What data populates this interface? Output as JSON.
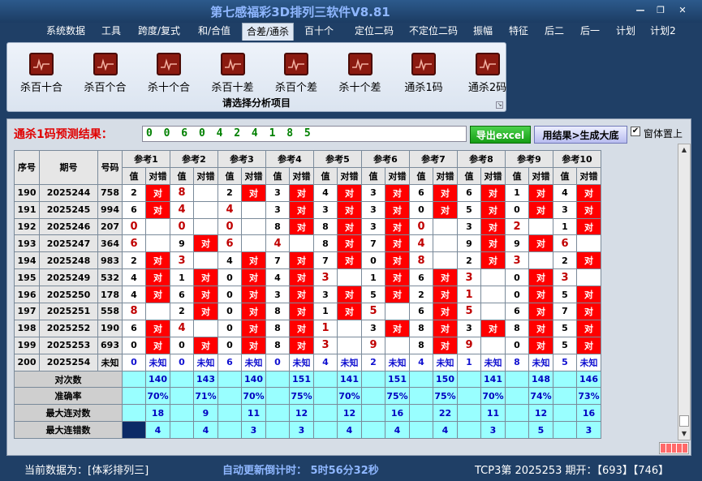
{
  "window": {
    "title": "第七感福彩3D排列三软件V8.81",
    "buttons": [
      "—",
      "❐",
      "✕"
    ]
  },
  "menu": {
    "items": [
      "系统数据",
      "工具",
      "跨度/复式",
      "和/合值",
      "合差/通杀",
      "百十个",
      "定位二码",
      "不定位二码",
      "振幅",
      "特征",
      "后二",
      "后一",
      "计划",
      "计划2"
    ],
    "active_index": 4
  },
  "ribbon": {
    "buttons": [
      "杀百十合",
      "杀百个合",
      "杀十个合",
      "杀百十差",
      "杀百个差",
      "杀十个差",
      "通杀1码",
      "通杀2码"
    ],
    "caption": "请选择分析项目",
    "launcher": "↘"
  },
  "result": {
    "label": "通杀1码预测结果：",
    "value": "0 0 6 0 4 2 4 1 8 5",
    "export_label": "导出excel",
    "generate_label": "用结果>生成大底",
    "topmost_checked": true,
    "topmost_label": "窗体置上"
  },
  "table": {
    "col_seq": "序号",
    "col_issue": "期号",
    "col_code": "号码",
    "ref_headers": [
      "参考1",
      "参考2",
      "参考3",
      "参考4",
      "参考5",
      "参考6",
      "参考7",
      "参考8",
      "参考9",
      "参考10"
    ],
    "sub_value": "值",
    "sub_result": "对错",
    "hit_text": "对",
    "rows": [
      {
        "seq": "190",
        "issue": "2025244",
        "code": "758",
        "vals": [
          "2",
          "8",
          "2",
          "3",
          "4",
          "3",
          "6",
          "6",
          "1",
          "4"
        ],
        "hits": [
          1,
          0,
          1,
          1,
          1,
          1,
          1,
          1,
          1,
          1
        ]
      },
      {
        "seq": "191",
        "issue": "2025245",
        "code": "994",
        "vals": [
          "6",
          "4",
          "4",
          "3",
          "3",
          "3",
          "0",
          "5",
          "0",
          "3"
        ],
        "hits": [
          1,
          0,
          0,
          1,
          1,
          1,
          1,
          1,
          1,
          1
        ]
      },
      {
        "seq": "192",
        "issue": "2025246",
        "code": "207",
        "vals": [
          "0",
          "0",
          "0",
          "8",
          "8",
          "3",
          "0",
          "3",
          "2",
          "1"
        ],
        "hits": [
          0,
          0,
          0,
          1,
          1,
          1,
          0,
          1,
          0,
          1
        ]
      },
      {
        "seq": "193",
        "issue": "2025247",
        "code": "364",
        "vals": [
          "6",
          "9",
          "6",
          "4",
          "8",
          "7",
          "4",
          "9",
          "9",
          "6"
        ],
        "hits": [
          0,
          1,
          0,
          0,
          1,
          1,
          0,
          1,
          1,
          0
        ]
      },
      {
        "seq": "194",
        "issue": "2025248",
        "code": "983",
        "vals": [
          "2",
          "3",
          "4",
          "7",
          "7",
          "0",
          "8",
          "2",
          "3",
          "2"
        ],
        "hits": [
          1,
          0,
          1,
          1,
          1,
          1,
          0,
          1,
          0,
          1
        ]
      },
      {
        "seq": "195",
        "issue": "2025249",
        "code": "532",
        "vals": [
          "4",
          "1",
          "0",
          "4",
          "3",
          "1",
          "6",
          "3",
          "0",
          "3"
        ],
        "hits": [
          1,
          1,
          1,
          1,
          0,
          1,
          1,
          0,
          1,
          0
        ]
      },
      {
        "seq": "196",
        "issue": "2025250",
        "code": "178",
        "vals": [
          "4",
          "6",
          "0",
          "3",
          "3",
          "5",
          "2",
          "1",
          "0",
          "5"
        ],
        "hits": [
          1,
          1,
          1,
          1,
          1,
          1,
          1,
          0,
          1,
          1
        ]
      },
      {
        "seq": "197",
        "issue": "2025251",
        "code": "558",
        "vals": [
          "8",
          "2",
          "0",
          "8",
          "1",
          "5",
          "6",
          "5",
          "6",
          "7"
        ],
        "hits": [
          0,
          1,
          1,
          1,
          1,
          0,
          1,
          0,
          1,
          1
        ]
      },
      {
        "seq": "198",
        "issue": "2025252",
        "code": "190",
        "vals": [
          "6",
          "4",
          "0",
          "8",
          "1",
          "3",
          "8",
          "3",
          "8",
          "5"
        ],
        "hits": [
          1,
          0,
          1,
          1,
          0,
          1,
          1,
          1,
          1,
          1
        ]
      },
      {
        "seq": "199",
        "issue": "2025253",
        "code": "693",
        "vals": [
          "0",
          "0",
          "0",
          "8",
          "3",
          "9",
          "8",
          "9",
          "0",
          "5"
        ],
        "hits": [
          1,
          1,
          1,
          1,
          0,
          0,
          1,
          0,
          1,
          1
        ]
      }
    ],
    "predict": {
      "seq": "200",
      "issue": "2025254",
      "code": "未知",
      "vals": [
        "0",
        "0",
        "6",
        "0",
        "4",
        "2",
        "4",
        "1",
        "8",
        "5"
      ],
      "result": "未知"
    },
    "stats": [
      {
        "label": "对次数",
        "values": [
          "140",
          "143",
          "140",
          "151",
          "141",
          "151",
          "150",
          "141",
          "148",
          "146"
        ]
      },
      {
        "label": "准确率",
        "values": [
          "70%",
          "71%",
          "70%",
          "75%",
          "70%",
          "75%",
          "75%",
          "70%",
          "74%",
          "73%"
        ]
      },
      {
        "label": "最大连对数",
        "values": [
          "18",
          "9",
          "11",
          "12",
          "12",
          "16",
          "22",
          "11",
          "12",
          "16"
        ]
      },
      {
        "label": "最大连错数",
        "values": [
          "4",
          "4",
          "3",
          "3",
          "4",
          "4",
          "4",
          "3",
          "5",
          "3"
        ]
      }
    ]
  },
  "status": {
    "source": "当前数据为：[体彩排列三]",
    "countdown": "自动更新倒计时：  5时56分32秒",
    "draw": "TCP3第  2025253  期开：【693】【746】"
  }
}
